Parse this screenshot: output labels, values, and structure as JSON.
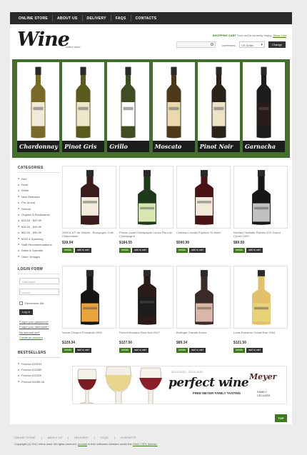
{
  "topnav": [
    "ONLINE STORE",
    "ABOUT US",
    "DELIVERY",
    "FAQS",
    "CONTACTS"
  ],
  "header": {
    "logo": "Wine",
    "logo_sub": "online store",
    "cart_label": "SHOPPING CART",
    "cart_text": "Your cart is currently empty.",
    "cart_link": "Show Cart",
    "currency_label": "currencies:",
    "currency_value": "US Dollar",
    "change_label": "Change"
  },
  "banner": [
    {
      "name": "Chardonnay",
      "glass": "#7a6a2a",
      "label": "#f1ead8"
    },
    {
      "name": "Pinot Gris",
      "glass": "#5a5a1c",
      "label": "#efe7c9"
    },
    {
      "name": "Grillo",
      "glass": "#3e4e22",
      "label": "#ffffff"
    },
    {
      "name": "Moscato",
      "glass": "#4a3a1a",
      "label": "#e9d9b0"
    },
    {
      "name": "Pinot Noir",
      "glass": "#2a2418",
      "label": "#eee3c7"
    },
    {
      "name": "Garnacha",
      "glass": "#1c1c1c",
      "label": "#2a1a1a"
    }
  ],
  "sidebar": {
    "categories_title": "CATEGORIES",
    "categories": [
      "Red",
      "Rose",
      "White",
      "New Releases",
      "Pre-Arrival",
      "Refund",
      "Organic & Biodynamic",
      "$15.00 - $29.99",
      "$30.00 - $49.99",
      "$50.00 - $99.99",
      "$100 & Sparkling",
      "Staff Recommendations",
      "Sales & Specials",
      "Older Vintages"
    ],
    "login_title": "LOGIN FORM",
    "username_placeholder": "Username",
    "password_placeholder": "••••••••",
    "remember_label": "Remember Me",
    "login_button": "Log in",
    "forgot_password": "Forgot your password?",
    "forgot_username": "Forgot your username?",
    "no_account": "No account yet?",
    "create_account": "Create an account",
    "bestsellers_title": "BESTSELLERS",
    "bestsellers": [
      "Product #19034",
      "Product #12089",
      "Product #12026",
      "Product #4489-08"
    ]
  },
  "products": [
    {
      "name": "2009 A & P de Villaine - Bourgogne Cote Chalonnaise",
      "price": "$39.94",
      "bottle": "#3a1c1c",
      "label": "#f2ecdc"
    },
    {
      "name": "Perrier-Jouet Champagne Cuvee Fleur de Champagne",
      "price": "$184.55",
      "bottle": "#1f3a1a",
      "label": "#d8e6b0"
    },
    {
      "name": "Chateau Leoville Poyferre St Julien",
      "price": "$590.99",
      "bottle": "#4a1414",
      "label": "#f1ead8"
    },
    {
      "name": "Nicolas Feuillatte Palmes d'Or Grand Cuvee 1999",
      "price": "$89.50",
      "bottle": "#161616",
      "label": "#c0c0c0"
    },
    {
      "name": "Veuve Clicquot Ponsardin 1990",
      "price": "$129.34",
      "bottle": "#161616",
      "label": "#e8a33a"
    },
    {
      "name": "Robert Mondavi Pinot Noir 2007",
      "price": "$127.50",
      "bottle": "#2a1a1a",
      "label": "#1c1c1c"
    },
    {
      "name": "Bollinger Grande Annee",
      "price": "$89.34",
      "bottle": "#3a2a2a",
      "label": "#d9b6a6"
    },
    {
      "name": "Louis Roederer Cristal Brut 2004",
      "price": "$121.50",
      "bottle": "#e3c06a",
      "label": "#e8d27a"
    }
  ],
  "buttons": {
    "details": "details",
    "add": "add to cart"
  },
  "promo": {
    "date": "20.12.2012 - 22.01.2013",
    "title": "perfect wine",
    "subtitle": "FREE MEYER FAMILY TASTING",
    "brand": "Meyer",
    "brand_sub1": "FAMILY",
    "brand_sub2": "CELLARS"
  },
  "totop": "TOP",
  "footer": {
    "nav": [
      "ONLINE STORE",
      "ABOUT US",
      "DELIVERY",
      "FAQS",
      "CONTACTS"
    ],
    "copy_pre": "Copyright (c) 2012 virtue mart. All rights reserved.",
    "copy_link": "joomla!",
    "copy_mid": "is free software released under the",
    "copy_link2": "GNU / GPL license."
  }
}
